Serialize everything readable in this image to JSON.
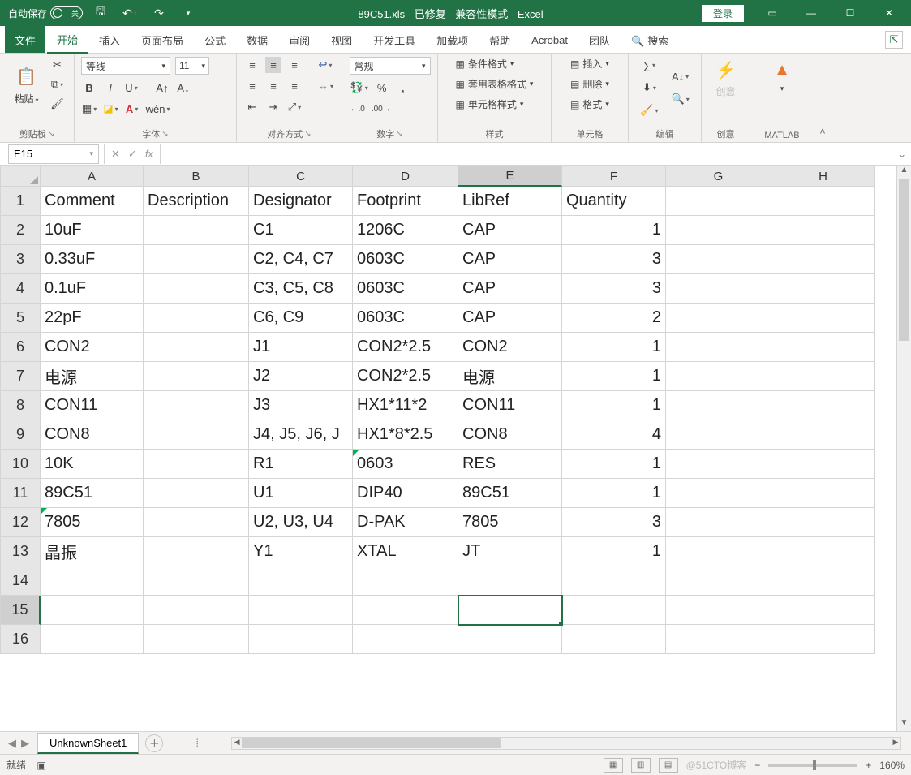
{
  "titlebar": {
    "autosave": "自动保存",
    "autosave_state": "关",
    "title": "89C51.xls - 已修复 - 兼容性模式 - Excel",
    "login": "登录"
  },
  "tabs": {
    "file": "文件",
    "home": "开始",
    "insert": "插入",
    "layout": "页面布局",
    "formulas": "公式",
    "data": "数据",
    "review": "审阅",
    "view": "视图",
    "dev": "开发工具",
    "addins": "加载项",
    "help": "帮助",
    "acrobat": "Acrobat",
    "team": "团队",
    "search": "搜索"
  },
  "ribbon": {
    "paste": "粘贴",
    "clipboard": "剪贴板",
    "font_name": "等线",
    "font_size": "11",
    "font_group": "字体",
    "phonetic": "wén",
    "align_group": "对齐方式",
    "number_format": "常规",
    "number_group": "数字",
    "cond_fmt": "条件格式",
    "table_fmt": "套用表格格式",
    "cell_styles": "单元格样式",
    "styles_group": "样式",
    "insert_btn": "插入",
    "delete_btn": "删除",
    "format_btn": "格式",
    "cells_group": "单元格",
    "editing_group": "编辑",
    "ideas": "创意",
    "ideas_group": "创意",
    "matlab_group": "MATLAB"
  },
  "formula_bar": {
    "namebox": "E15",
    "fx": "fx"
  },
  "columns": [
    "A",
    "B",
    "C",
    "D",
    "E",
    "F",
    "G",
    "H"
  ],
  "row_numbers": [
    "1",
    "2",
    "3",
    "4",
    "5",
    "6",
    "7",
    "8",
    "9",
    "10",
    "11",
    "12",
    "13",
    "14",
    "15",
    "16"
  ],
  "headers": {
    "A": "Comment",
    "B": "Description",
    "C": "Designator",
    "D": "Footprint",
    "E": "LibRef",
    "F": "Quantity",
    "G": "",
    "H": ""
  },
  "rows": [
    {
      "A": "10uF",
      "B": "",
      "C": "C1",
      "D": "1206C",
      "E": "CAP",
      "F": "1"
    },
    {
      "A": "0.33uF",
      "B": "",
      "C": "C2, C4, C7",
      "D": "0603C",
      "E": "CAP",
      "F": "3"
    },
    {
      "A": "0.1uF",
      "B": "",
      "C": "C3, C5, C8",
      "D": "0603C",
      "E": "CAP",
      "F": "3"
    },
    {
      "A": "22pF",
      "B": "",
      "C": "C6, C9",
      "D": "0603C",
      "E": "CAP",
      "F": "2"
    },
    {
      "A": "CON2",
      "B": "",
      "C": "J1",
      "D": "CON2*2.5",
      "E": "CON2",
      "F": "1"
    },
    {
      "A": "电源",
      "B": "",
      "C": "J2",
      "D": "CON2*2.5",
      "E": "电源",
      "F": "1"
    },
    {
      "A": "CON11",
      "B": "",
      "C": "J3",
      "D": "HX1*11*2",
      "E": "CON11",
      "F": "1"
    },
    {
      "A": "CON8",
      "B": "",
      "C": "J4, J5, J6, J",
      "D": "HX1*8*2.5",
      "E": "CON8",
      "F": "4"
    },
    {
      "A": "10K",
      "B": "",
      "C": "R1",
      "D": "0603",
      "E": "RES",
      "F": "1",
      "triD": true
    },
    {
      "A": "89C51",
      "B": "",
      "C": "U1",
      "D": "DIP40",
      "E": "89C51",
      "F": "1"
    },
    {
      "A": "7805",
      "B": "",
      "C": "U2, U3, U4",
      "D": "D-PAK",
      "E": "7805",
      "F": "3",
      "triA": true
    },
    {
      "A": "晶振",
      "B": "",
      "C": "Y1",
      "D": "XTAL",
      "E": "JT",
      "F": "1"
    }
  ],
  "active_cell": {
    "row": 15,
    "col": "E"
  },
  "sheet": {
    "name": "UnknownSheet1"
  },
  "status": {
    "ready": "就绪",
    "zoom": "160%",
    "watermark": "@51CTO博客"
  }
}
